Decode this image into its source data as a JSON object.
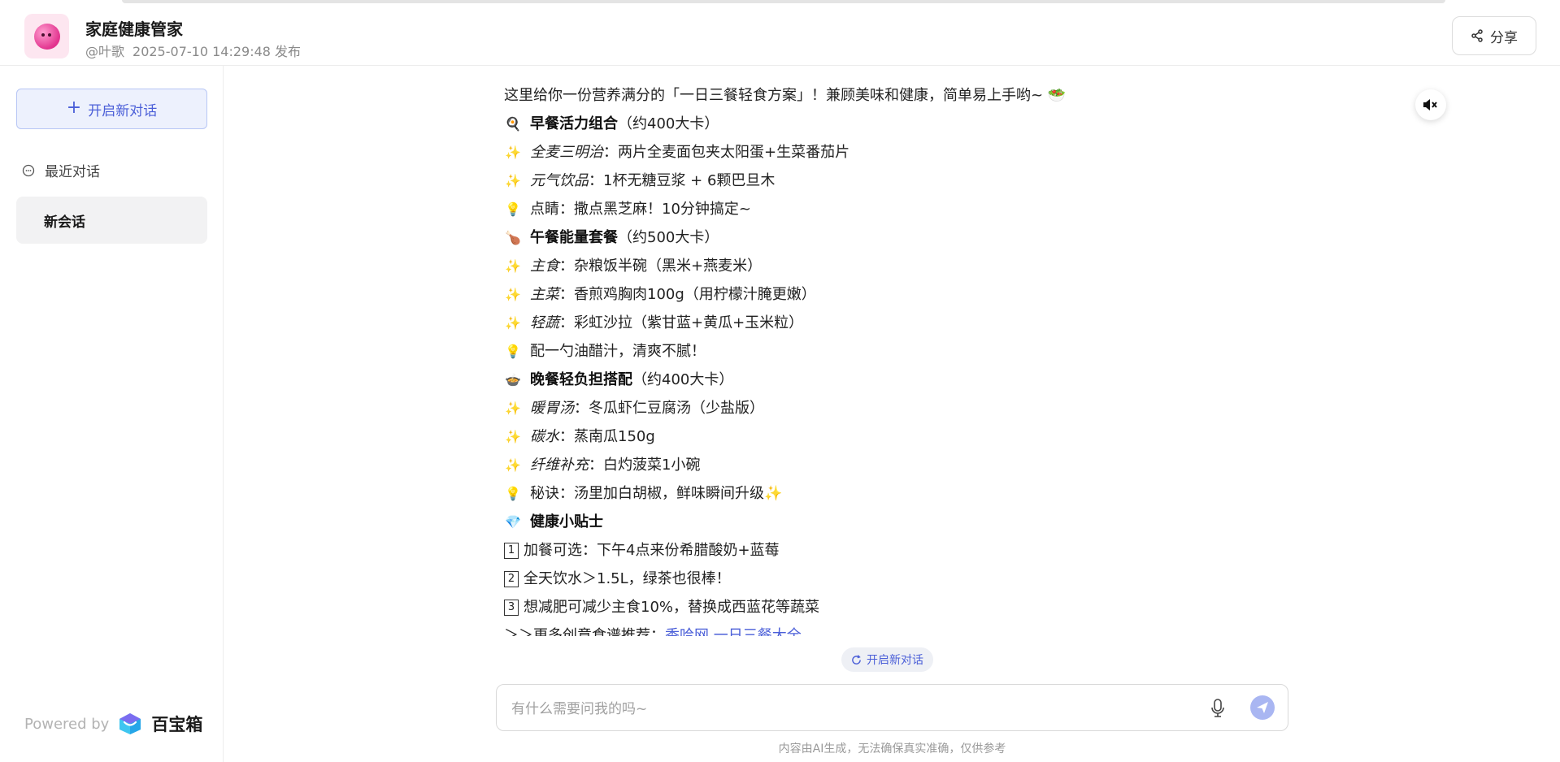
{
  "header": {
    "app_title": "家庭健康管家",
    "author": "@叶歌",
    "published": "2025-07-10 14:29:48 发布",
    "share_label": "分享"
  },
  "sidebar": {
    "new_chat_label": "开启新对话",
    "recent_label": "最近对话",
    "sessions": [
      {
        "label": "新会话"
      }
    ],
    "powered_by": "Powered by",
    "brand_name": "百宝箱"
  },
  "message": {
    "intro": "这里给你一份营养满分的「一日三餐轻食方案」！兼顾美味和健康，简单易上手哟~ 🥗",
    "breakfast": {
      "icon": "🍳",
      "title": "早餐活力组合",
      "kcal": "（约400大卡）"
    },
    "breakfast_items": [
      {
        "icon": "✨",
        "label": "全麦三明治",
        "text": "：两片全麦面包夹太阳蛋+生菜番茄片"
      },
      {
        "icon": "✨",
        "label": "元气饮品",
        "text": "：1杯无糖豆浆 + 6颗巴旦木"
      }
    ],
    "breakfast_tip": {
      "icon": "💡",
      "text": "点睛：撒点黑芝麻！10分钟搞定~"
    },
    "lunch": {
      "icon": "🍗",
      "title": "午餐能量套餐",
      "kcal": "（约500大卡）"
    },
    "lunch_items": [
      {
        "icon": "✨",
        "label": "主食",
        "text": "：杂粮饭半碗（黑米+燕麦米）"
      },
      {
        "icon": "✨",
        "label": "主菜",
        "text": "：香煎鸡胸肉100g（用柠檬汁腌更嫩）"
      },
      {
        "icon": "✨",
        "label": "轻蔬",
        "text": "：彩虹沙拉（紫甘蓝+黄瓜+玉米粒）"
      }
    ],
    "lunch_tip": {
      "icon": "💡",
      "text": "配一勺油醋汁，清爽不腻！"
    },
    "dinner": {
      "icon": "🍲",
      "title": "晚餐轻负担搭配",
      "kcal": "（约400大卡）"
    },
    "dinner_items": [
      {
        "icon": "✨",
        "label": "暖胃汤",
        "text": "：冬瓜虾仁豆腐汤（少盐版）"
      },
      {
        "icon": "✨",
        "label": "碳水",
        "text": "：蒸南瓜150g"
      },
      {
        "icon": "✨",
        "label": "纤维补充",
        "text": "：白灼菠菜1小碗"
      }
    ],
    "dinner_tip": {
      "icon": "💡",
      "text": "秘诀：汤里加白胡椒，鲜味瞬间升级✨"
    },
    "tips": {
      "icon": "💎",
      "title": "健康小贴士"
    },
    "tip_items": [
      {
        "num": "1",
        "text": "加餐可选：下午4点来份希腊酸奶+蓝莓"
      },
      {
        "num": "2",
        "text": "全天饮水＞1.5L，绿茶也很棒！"
      },
      {
        "num": "3",
        "text": "想减肥可减少主食10%，替换成西蓝花等蔬菜"
      }
    ],
    "more": {
      "text": "＞＞更多创意食谱推荐：",
      "link": "香哈网 一日三餐大全"
    }
  },
  "composer": {
    "restart_label": "开启新对话",
    "placeholder": "有什么需要问我的吗~",
    "disclaimer": "内容由AI生成，无法确保真实准确，仅供参考"
  },
  "colors": {
    "accent": "#4b5fd8",
    "accent_bg": "#edf1fd",
    "send_button": "#a9b6f2"
  },
  "icons": {
    "share": "share-icon",
    "mute": "speaker-mute-icon",
    "mic": "microphone-icon",
    "send": "send-icon",
    "refresh": "refresh-icon",
    "chat": "chat-bubble-icon"
  }
}
